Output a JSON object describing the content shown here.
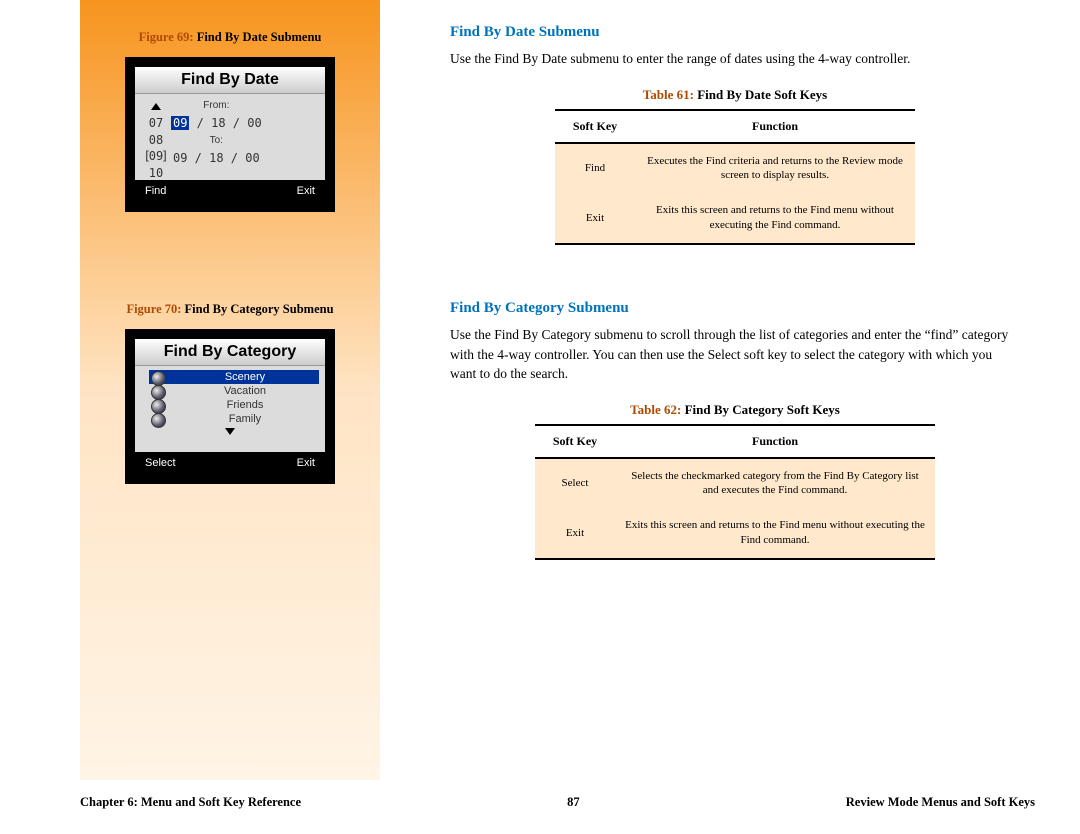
{
  "sidebar": {
    "fig1": {
      "num": "Figure 69:",
      "caption": "Find By Date Submenu",
      "screen_title": "Find By Date",
      "row_nums": [
        "07",
        "08",
        "09",
        "10"
      ],
      "from_label": "From:",
      "from_date_hl": "09",
      "from_date_rest": " / 18 / 00",
      "to_label": "To:",
      "to_date": "09 / 18 / 00",
      "soft_left": "Find",
      "soft_right": "Exit"
    },
    "fig2": {
      "num": "Figure 70:",
      "caption": "Find By Category Submenu",
      "screen_title": "Find By Category",
      "items": [
        "Scenery",
        "Vacation",
        "Friends",
        "Family"
      ],
      "soft_left": "Select",
      "soft_right": "Exit"
    }
  },
  "main": {
    "sect1": {
      "heading": "Find By Date Submenu",
      "body": "Use the Find By Date submenu to enter the range of dates using the 4-way controller."
    },
    "table1": {
      "num": "Table 61:",
      "caption": "Find By Date Soft Keys",
      "col1": "Soft Key",
      "col2": "Function",
      "rows": [
        {
          "k": "Find",
          "f": "Executes the Find criteria and returns to the Review mode screen to display results."
        },
        {
          "k": "Exit",
          "f": "Exits this screen and returns to the Find menu without executing the Find command."
        }
      ]
    },
    "sect2": {
      "heading": "Find By Category Submenu",
      "body": "Use the Find By Category submenu to scroll through the list of categories and enter the “find” category with the 4-way controller. You can then use the Select soft key to select the category with which you want to do the search."
    },
    "table2": {
      "num": "Table 62:",
      "caption": "Find By Category Soft Keys",
      "col1": "Soft Key",
      "col2": "Function",
      "rows": [
        {
          "k": "Select",
          "f": "Selects the checkmarked category from the Find By Category list and executes the Find command."
        },
        {
          "k": "Exit",
          "f": "Exits this screen and returns to the Find menu without executing the Find command."
        }
      ]
    }
  },
  "footer": {
    "left": "Chapter 6: Menu and Soft Key Reference",
    "page": "87",
    "right": "Review Mode Menus and Soft Keys"
  }
}
